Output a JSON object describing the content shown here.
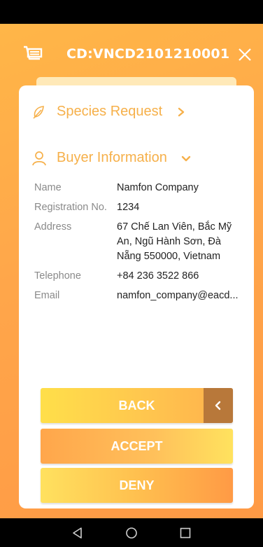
{
  "header": {
    "title": "CD:VNCD2101210001",
    "cart_icon": "cart-icon",
    "close_icon": "close-icon"
  },
  "sections": {
    "species": {
      "label": "Species Request",
      "icon": "leaf-icon",
      "chevron": "chevron-right-icon"
    },
    "buyer": {
      "label": "Buyer Information",
      "icon": "user-icon",
      "chevron": "chevron-down-icon"
    }
  },
  "buyer_info": [
    {
      "label": "Name",
      "value": "Namfon Company"
    },
    {
      "label": "Registration No.",
      "value": "1234"
    },
    {
      "label": "Address",
      "value": "67 Chế Lan Viên, Bắc Mỹ An, Ngũ Hành Sơn, Đà Nẵng 550000, Vietnam"
    },
    {
      "label": "Telephone",
      "value": "+84 236 3522 866"
    },
    {
      "label": "Email",
      "value": "namfon_company@eacd..."
    }
  ],
  "buttons": {
    "back": "BACK",
    "accept": "ACCEPT",
    "deny": "DENY"
  },
  "colors": {
    "accent": "#f6b04a",
    "back_handle": "#b8783a"
  }
}
